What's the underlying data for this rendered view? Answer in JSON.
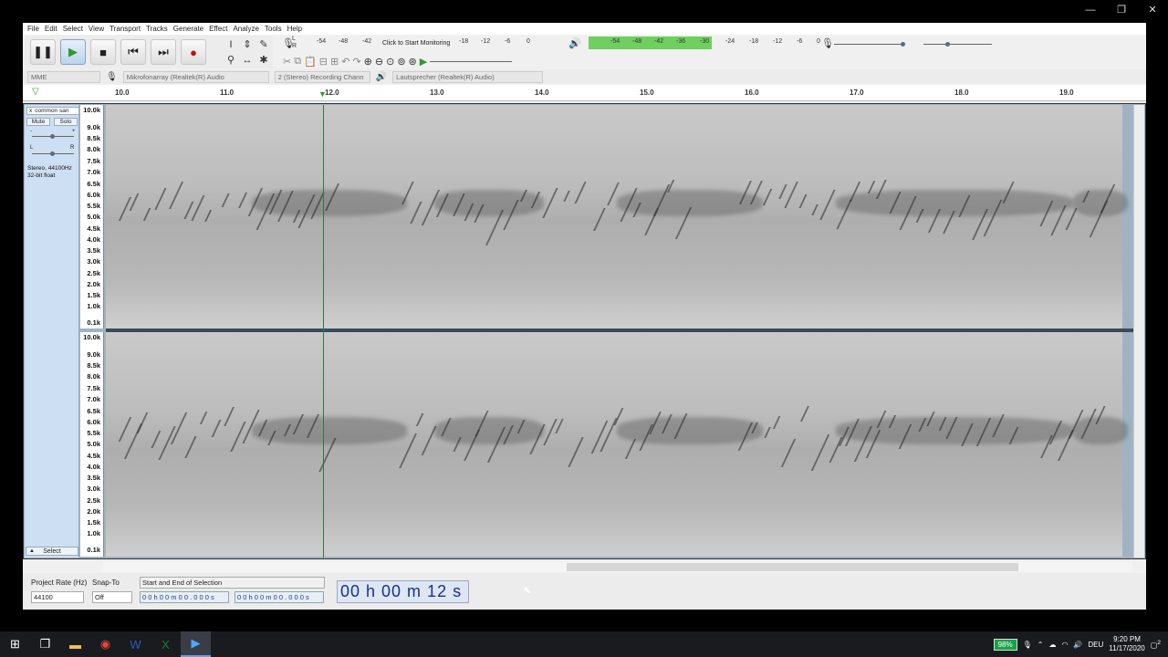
{
  "window_controls": [
    "—",
    "❐",
    "✕"
  ],
  "menu": [
    "File",
    "Edit",
    "Select",
    "View",
    "Transport",
    "Tracks",
    "Generate",
    "Effect",
    "Analyze",
    "Tools",
    "Help"
  ],
  "meter": {
    "rec_label": "Click to Start Monitoring",
    "rec_ticks": [
      "-54",
      "-48",
      "-42",
      "-18",
      "-12",
      "-6",
      "0"
    ],
    "play_ticks": [
      "-54",
      "-48",
      "-42",
      "-36",
      "-30",
      "-24",
      "-18",
      "-12",
      "-6",
      "0"
    ],
    "rec_level_letters": [
      "L",
      "R"
    ]
  },
  "devices": {
    "host": "MME",
    "mic": "Mikrofonarray (Realtek(R) Audio",
    "channels": "2 (Stereo) Recording Chann",
    "speaker": "Lautsprecher (Realtek(R) Audio)"
  },
  "ruler": [
    "10.0",
    "11.0",
    "12.0",
    "13.0",
    "14.0",
    "15.0",
    "16.0",
    "17.0",
    "18.0",
    "19.0"
  ],
  "track": {
    "name": "common san",
    "mute": "Mute",
    "solo": "Solo",
    "pan_left": "L",
    "pan_right": "R",
    "gain_minus": "-",
    "gain_plus": "+",
    "desc1": "Stereo, 44100Hz",
    "desc2": "32-bit float",
    "select": "Select",
    "collapse": "▲",
    "close": "x"
  },
  "scale": [
    "10.0k",
    "9.0k",
    "8.5k",
    "8.0k",
    "7.5k",
    "7.0k",
    "6.5k",
    "6.0k",
    "5.5k",
    "5.0k",
    "4.5k",
    "4.0k",
    "3.5k",
    "3.0k",
    "2.5k",
    "2.0k",
    "1.5k",
    "1.0k",
    "0.1k"
  ],
  "selection": {
    "rate_label": "Project Rate (Hz)",
    "rate": "44100",
    "snap_label": "Snap-To",
    "snap": "Off",
    "mode": "Start and End of Selection",
    "start": "0 0 h 0 0 m 0 0 . 0 0 0 s",
    "end": "0 0 h 0 0 m 0 0 . 0 0 0 s",
    "time": "00 h 00 m 12 s"
  },
  "tray": {
    "battery": "98%",
    "lang": "DEU",
    "time": "9:20 PM",
    "date": "11/17/2020",
    "notif": "2"
  }
}
